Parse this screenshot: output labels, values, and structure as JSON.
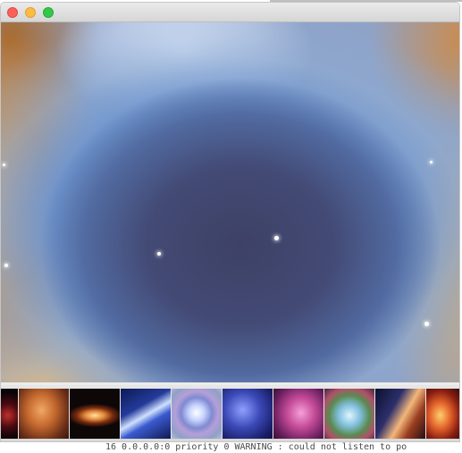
{
  "terminal": {
    "text": "16 0.0.0.0:0 priority 0 WARNING : could not listen to po"
  },
  "window": {
    "traffic_lights": [
      {
        "name": "close-button",
        "color": "#fc605c"
      },
      {
        "name": "minimize-button",
        "color": "#fdbc40"
      },
      {
        "name": "zoom-button",
        "color": "#34c84a"
      }
    ]
  },
  "main_image": {
    "icon": "nebula-image"
  },
  "thumbnails": [
    {
      "icon": "nebula-thumbnail-dark-red"
    },
    {
      "icon": "nebula-thumbnail-orange-cloud"
    },
    {
      "icon": "nebula-thumbnail-butterfly"
    },
    {
      "icon": "nebula-thumbnail-blue-jet"
    },
    {
      "icon": "nebula-thumbnail-cats-eye"
    },
    {
      "icon": "nebula-thumbnail-star-field"
    },
    {
      "icon": "nebula-thumbnail-pink-cloud"
    },
    {
      "icon": "nebula-thumbnail-crab"
    },
    {
      "icon": "nebula-thumbnail-pillars"
    },
    {
      "icon": "nebula-thumbnail-red-fire"
    }
  ]
}
